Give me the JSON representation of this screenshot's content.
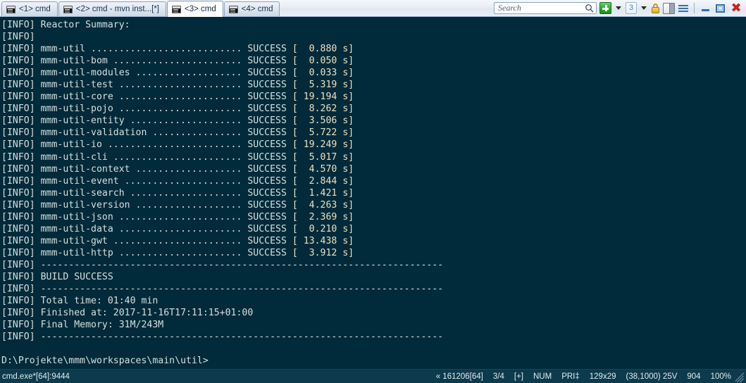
{
  "window": {
    "tabs": [
      {
        "label": "<1> cmd",
        "active": false,
        "icon": "console-icon"
      },
      {
        "label": "<2> cmd - mvn  inst...[*]",
        "active": false,
        "icon": "console-icon"
      },
      {
        "label": "<3> cmd",
        "active": true,
        "icon": "console-icon"
      },
      {
        "label": "<4> cmd",
        "active": false,
        "icon": "console-icon"
      }
    ],
    "toolbar": {
      "search_placeholder": "Search",
      "search_value": "",
      "search_icon": "magnifier-icon",
      "new_tab_icon": "plus-icon",
      "new_tab_caret_icon": "chevron-down-icon",
      "tab_count_label": "3",
      "tab_count_caret_icon": "chevron-down-icon",
      "lock_icon": "lock-icon",
      "panel_icon": "panel-toggle-icon",
      "menu_icon": "hamburger-menu-icon",
      "minimize_icon": "minimize-icon",
      "maximize_icon": "maximize-icon",
      "close_icon": "close-icon"
    }
  },
  "console": {
    "lines": [
      "[INFO] Reactor Summary:",
      "[INFO]",
      "[INFO] mmm-util ........................... SUCCESS [  0.880 s]",
      "[INFO] mmm-util-bom ....................... SUCCESS [  0.050 s]",
      "[INFO] mmm-util-modules ................... SUCCESS [  0.033 s]",
      "[INFO] mmm-util-test ...................... SUCCESS [  5.319 s]",
      "[INFO] mmm-util-core ...................... SUCCESS [ 19.194 s]",
      "[INFO] mmm-util-pojo ...................... SUCCESS [  8.262 s]",
      "[INFO] mmm-util-entity .................... SUCCESS [  3.506 s]",
      "[INFO] mmm-util-validation ................ SUCCESS [  5.722 s]",
      "[INFO] mmm-util-io ........................ SUCCESS [ 19.249 s]",
      "[INFO] mmm-util-cli ....................... SUCCESS [  5.017 s]",
      "[INFO] mmm-util-context ................... SUCCESS [  4.570 s]",
      "[INFO] mmm-util-event ..................... SUCCESS [  2.844 s]",
      "[INFO] mmm-util-search .................... SUCCESS [  1.421 s]",
      "[INFO] mmm-util-version ................... SUCCESS [  4.263 s]",
      "[INFO] mmm-util-json ...................... SUCCESS [  2.369 s]",
      "[INFO] mmm-util-data ...................... SUCCESS [  0.210 s]",
      "[INFO] mmm-util-gwt ....................... SUCCESS [ 13.438 s]",
      "[INFO] mmm-util-http ...................... SUCCESS [  3.912 s]",
      "[INFO] ------------------------------------------------------------------------",
      "[INFO] BUILD SUCCESS",
      "[INFO] ------------------------------------------------------------------------",
      "[INFO] Total time: 01:40 min",
      "[INFO] Finished at: 2017-11-16T17:11:15+01:00",
      "[INFO] Final Memory: 31M/243M",
      "[INFO] ------------------------------------------------------------------------"
    ],
    "prompt": "D:\\Projekte\\mmm\\workspaces\\main\\util>",
    "colors": {
      "background": "#012b3a",
      "foreground": "#d8dfe0"
    }
  },
  "statusbar": {
    "left": "cmd.exe*[64]:9444",
    "cells": [
      "« 161206[64]",
      "3/4",
      "[+]",
      "NUM",
      "PRI‡",
      "129x29",
      "(38,1000) 25V",
      "904",
      "100%"
    ],
    "resize_grip_icon": "resize-grip-icon",
    "colors": {
      "background": "#0c3b4d",
      "foreground": "#e4eaec"
    }
  }
}
